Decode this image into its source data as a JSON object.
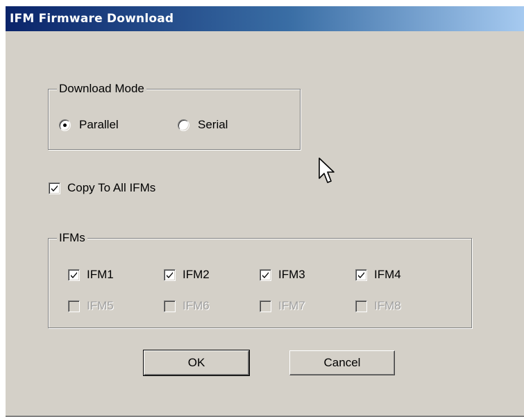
{
  "window": {
    "title": "IFM Firmware Download"
  },
  "download_mode": {
    "legend": "Download Mode",
    "options": [
      {
        "label": "Parallel",
        "selected": true
      },
      {
        "label": "Serial",
        "selected": false
      }
    ]
  },
  "copy_to_all": {
    "label": "Copy To All IFMs",
    "checked": true
  },
  "ifms": {
    "legend": "IFMs",
    "items": [
      {
        "label": "IFM1",
        "checked": true,
        "enabled": true
      },
      {
        "label": "IFM2",
        "checked": true,
        "enabled": true
      },
      {
        "label": "IFM3",
        "checked": true,
        "enabled": true
      },
      {
        "label": "IFM4",
        "checked": true,
        "enabled": true
      },
      {
        "label": "IFM5",
        "checked": false,
        "enabled": false
      },
      {
        "label": "IFM6",
        "checked": false,
        "enabled": false
      },
      {
        "label": "IFM7",
        "checked": false,
        "enabled": false
      },
      {
        "label": "IFM8",
        "checked": false,
        "enabled": false
      }
    ]
  },
  "buttons": {
    "ok_label": "OK",
    "cancel_label": "Cancel"
  },
  "icons": {
    "radio_selected": "radio-selected-icon",
    "radio_unselected": "radio-unselected-icon",
    "checkbox_checked": "checkmark-icon",
    "cursor": "mouse-pointer-icon"
  },
  "colors": {
    "dialog_background": "#d4d0c8",
    "titlebar_start": "#0a246a",
    "titlebar_end": "#a6caf0",
    "title_text": "#ffffff",
    "disabled_text": "#a0a0a0"
  }
}
